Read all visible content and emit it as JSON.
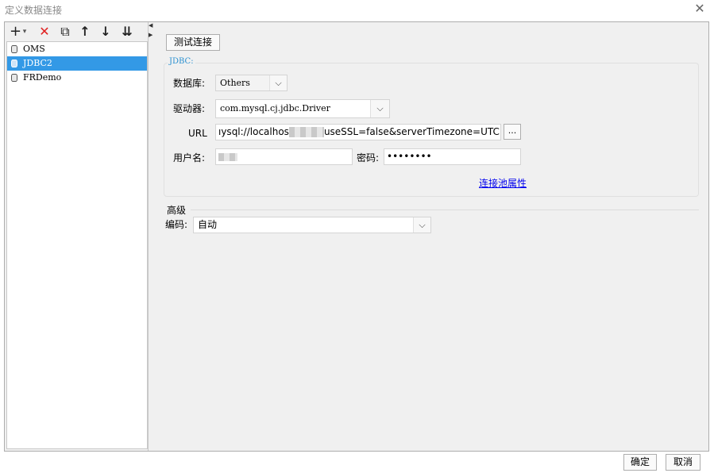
{
  "window": {
    "title": "定义数据连接"
  },
  "toolbar": {
    "add": "+",
    "add_dropdown": "▾",
    "delete": "✕",
    "copy": "⧉",
    "move_up": "↑",
    "move_down": "↓",
    "sort": "⇊"
  },
  "tree": {
    "items": [
      {
        "label": "OMS",
        "selected": false
      },
      {
        "label": "JDBC2",
        "selected": true
      },
      {
        "label": "FRDemo",
        "selected": false
      }
    ]
  },
  "connection": {
    "test_button": "测试连接",
    "group_title": "JDBC:",
    "database_label": "数据库:",
    "database_value": "Others",
    "driver_label": "驱动器:",
    "driver_value": "com.mysql.cj.jdbc.Driver",
    "url_label": "URL",
    "url_value_start": "ıysql://localhos",
    "url_value_end": "useSSL=false&serverTimezone=UTC",
    "url_browse": "...",
    "username_label": "用户名:",
    "password_label": "密码:",
    "password_value": "••••••••",
    "pool_link": "连接池属性"
  },
  "advanced": {
    "title": "高级",
    "encoding_label": "编码:",
    "encoding_value": "自动"
  },
  "footer": {
    "ok": "确定",
    "cancel": "取消"
  }
}
